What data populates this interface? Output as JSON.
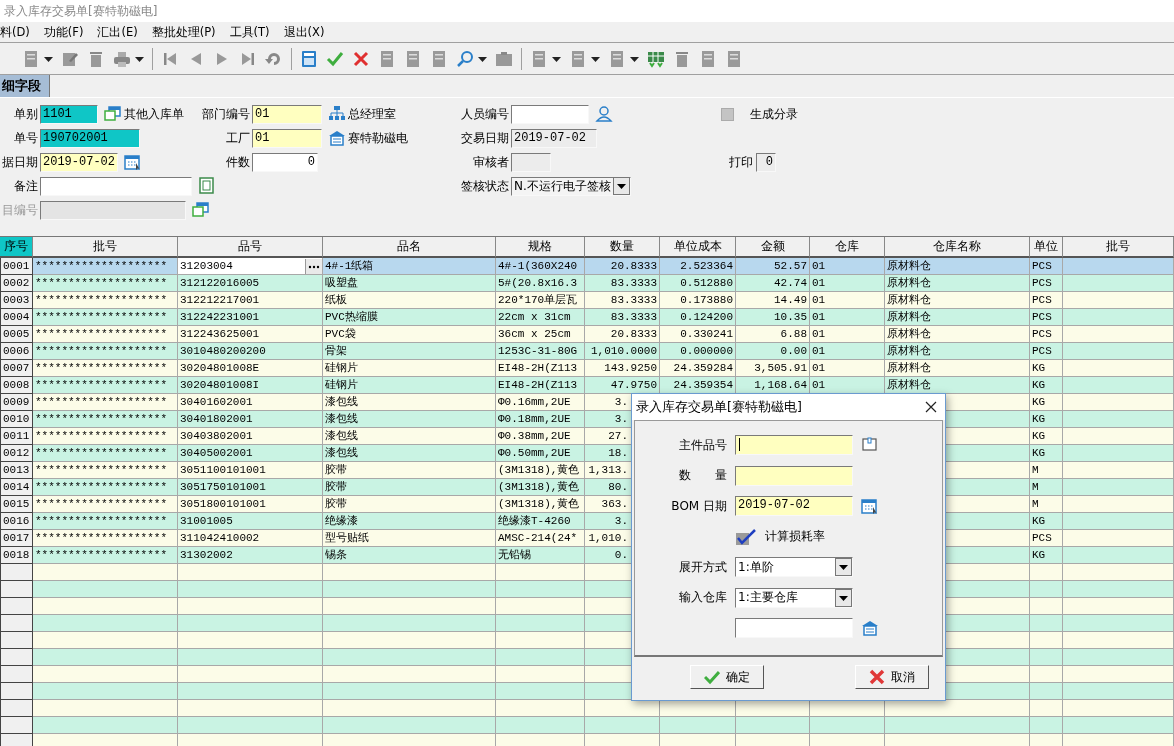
{
  "window": {
    "title": "录入库存交易单[赛特勒磁电]"
  },
  "menu": [
    "料(D)",
    "功能(F)",
    "汇出(E)",
    "整批处理(P)",
    "工具(T)",
    "退出(X)"
  ],
  "tab": {
    "label": "细字段",
    "selected": true
  },
  "form": {
    "doc_type": {
      "label": "单别",
      "value": "1101",
      "kind": "key",
      "link": "其他入库单"
    },
    "dept": {
      "label": "部门编号",
      "value": "01",
      "kind": "required",
      "link": "总经理室"
    },
    "staff": {
      "label": "人员编号",
      "kind": "normal"
    },
    "gen_entry": {
      "label": "生成分录",
      "checked": false
    },
    "doc_no": {
      "label": "单号",
      "value": "190702001",
      "kind": "key"
    },
    "factory": {
      "label": "工厂",
      "value": "01",
      "kind": "required",
      "link": "赛特勒磁电"
    },
    "trade_date": {
      "label": "交易日期",
      "value": "2019-07-02",
      "kind": "readonly"
    },
    "doc_date": {
      "label": "据日期",
      "value": "2019-07-02",
      "kind": "required"
    },
    "pieces": {
      "label": "件数",
      "value": "0",
      "kind": "normal"
    },
    "reviewer": {
      "label": "审核者",
      "kind": "readonly"
    },
    "print": {
      "label": "打印",
      "value": "0",
      "kind": "readonly"
    },
    "note": {
      "label": "备注",
      "kind": "normal"
    },
    "sign_status": {
      "label": "签核状态",
      "value": "N.不运行电子签核"
    },
    "project_no": {
      "label": "目编号",
      "kind": "disabled"
    }
  },
  "table": {
    "columns": [
      "序号",
      "批号",
      "品号",
      "品名",
      "规格",
      "数量",
      "单位成本",
      "金额",
      "仓库",
      "仓库名称",
      "单位",
      "批号"
    ],
    "rows": [
      {
        "seq": "0001",
        "batch": "********************",
        "item_no": "31203004",
        "name": "4#-1纸箱",
        "spec": "4#-1(360X240",
        "qty": "20.8333",
        "unit_cost": "2.523364",
        "amount": "52.57",
        "warehouse": "01",
        "warehouse_name": "原材料仓",
        "unit": "PCS",
        "selected": true
      },
      {
        "seq": "0002",
        "batch": "********************",
        "item_no": "312122016005",
        "name": "吸塑盘",
        "spec": "5#(20.8x16.3",
        "qty": "83.3333",
        "unit_cost": "0.512880",
        "amount": "42.74",
        "warehouse": "01",
        "warehouse_name": "原材料仓",
        "unit": "PCS",
        "selected": false
      },
      {
        "seq": "0003",
        "batch": "********************",
        "item_no": "312212217001",
        "name": "纸板",
        "spec": "220*170单层瓦",
        "qty": "83.3333",
        "unit_cost": "0.173880",
        "amount": "14.49",
        "warehouse": "01",
        "warehouse_name": "原材料仓",
        "unit": "PCS",
        "selected": false
      },
      {
        "seq": "0004",
        "batch": "********************",
        "item_no": "312242231001",
        "name": "PVC热缩膜",
        "spec": "22cm x 31cm",
        "qty": "83.3333",
        "unit_cost": "0.124200",
        "amount": "10.35",
        "warehouse": "01",
        "warehouse_name": "原材料仓",
        "unit": "PCS",
        "selected": false
      },
      {
        "seq": "0005",
        "batch": "********************",
        "item_no": "312243625001",
        "name": "PVC袋",
        "spec": "36cm x 25cm",
        "qty": "20.8333",
        "unit_cost": "0.330241",
        "amount": "6.88",
        "warehouse": "01",
        "warehouse_name": "原材料仓",
        "unit": "PCS",
        "selected": false
      },
      {
        "seq": "0006",
        "batch": "********************",
        "item_no": "3010480200200",
        "name": "骨架",
        "spec": "1253C-31-80G",
        "qty": "1,010.0000",
        "unit_cost": "0.000000",
        "amount": "0.00",
        "warehouse": "01",
        "warehouse_name": "原材料仓",
        "unit": "PCS",
        "selected": false
      },
      {
        "seq": "0007",
        "batch": "********************",
        "item_no": "30204801008E",
        "name": "硅钢片",
        "spec": "EI48-2H(Z113",
        "qty": "143.9250",
        "unit_cost": "24.359284",
        "amount": "3,505.91",
        "warehouse": "01",
        "warehouse_name": "原材料仓",
        "unit": "KG",
        "selected": false
      },
      {
        "seq": "0008",
        "batch": "********************",
        "item_no": "30204801008I",
        "name": "硅钢片",
        "spec": "EI48-2H(Z113",
        "qty": "47.9750",
        "unit_cost": "24.359354",
        "amount": "1,168.64",
        "warehouse": "01",
        "warehouse_name": "原材料仓",
        "unit": "KG",
        "selected": false
      },
      {
        "seq": "0009",
        "batch": "********************",
        "item_no": "30401602001",
        "name": "漆包线",
        "spec": "Φ0.16mm,2UE",
        "qty": "3.",
        "unit": "KG",
        "selected": false
      },
      {
        "seq": "0010",
        "batch": "********************",
        "item_no": "30401802001",
        "name": "漆包线",
        "spec": "Φ0.18mm,2UE",
        "qty": "3.",
        "unit": "KG",
        "selected": false
      },
      {
        "seq": "0011",
        "batch": "********************",
        "item_no": "30403802001",
        "name": "漆包线",
        "spec": "Φ0.38mm,2UE",
        "qty": "27.",
        "unit": "KG",
        "selected": false
      },
      {
        "seq": "0012",
        "batch": "********************",
        "item_no": "30405002001",
        "name": "漆包线",
        "spec": "Φ0.50mm,2UE",
        "qty": "18.",
        "unit": "KG",
        "selected": false
      },
      {
        "seq": "0013",
        "batch": "********************",
        "item_no": "3051100101001",
        "name": "胶带",
        "spec": "(3M1318),黄色",
        "qty": "1,313.",
        "unit": "M",
        "selected": false
      },
      {
        "seq": "0014",
        "batch": "********************",
        "item_no": "3051750101001",
        "name": "胶带",
        "spec": "(3M1318),黄色",
        "qty": "80.",
        "unit": "M",
        "selected": false
      },
      {
        "seq": "0015",
        "batch": "********************",
        "item_no": "3051800101001",
        "name": "胶带",
        "spec": "(3M1318),黄色",
        "qty": "363.",
        "unit": "M",
        "selected": false
      },
      {
        "seq": "0016",
        "batch": "********************",
        "item_no": "31001005",
        "name": "绝缘漆",
        "spec": "绝缘漆T-4260",
        "qty": "3.",
        "unit": "KG",
        "selected": false
      },
      {
        "seq": "0017",
        "batch": "********************",
        "item_no": "311042410002",
        "name": "型号贴纸",
        "spec": "AMSC-214(24*",
        "qty": "1,010.",
        "unit": "PCS",
        "selected": false
      },
      {
        "seq": "0018",
        "batch": "********************",
        "item_no": "31302002",
        "name": "锡条",
        "spec": "无铅锡",
        "qty": "0.",
        "unit": "KG",
        "selected": false
      }
    ]
  },
  "dialog": {
    "title": "录入库存交易单[赛特勒磁电]",
    "fields": [
      {
        "kind": "text",
        "label": "主件品号",
        "required": true,
        "focused": true
      },
      {
        "kind": "text",
        "label": "数　　量",
        "required": true
      },
      {
        "kind": "text",
        "label": "BOM 日期",
        "value": "2019-07-02",
        "required": true
      },
      {
        "kind": "checkbox",
        "label": "计算损耗率",
        "checked": true
      },
      {
        "kind": "select",
        "label": "展开方式",
        "value": "1:单阶"
      },
      {
        "kind": "select",
        "label": "输入仓库",
        "value": "1:主要仓库"
      },
      {
        "kind": "text",
        "required": false
      }
    ],
    "buttons": [
      {
        "kind": "ok",
        "label": "确定"
      },
      {
        "kind": "cancel",
        "label": "取消"
      }
    ]
  }
}
